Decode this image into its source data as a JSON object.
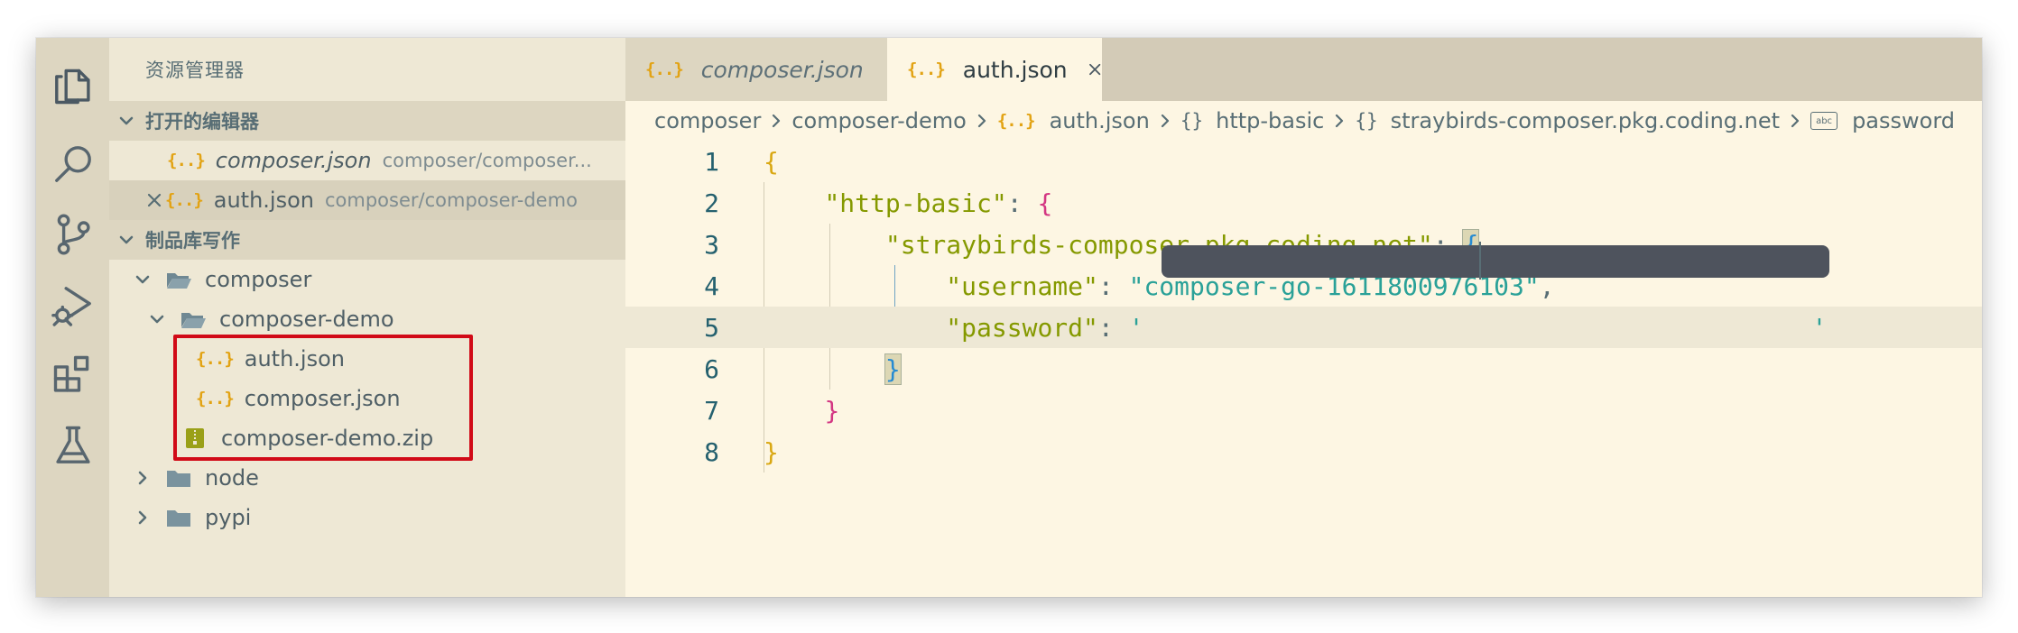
{
  "sidebar": {
    "title": "资源管理器",
    "open_editors": {
      "header": "打开的编辑器",
      "items": [
        {
          "name": "composer.json",
          "path": "composer/composer..."
        },
        {
          "name": "auth.json",
          "path": "composer/composer-demo"
        }
      ]
    },
    "repo": {
      "header": "制品库写作",
      "tree": [
        {
          "name": "composer"
        },
        {
          "name": "composer-demo"
        },
        {
          "name": "auth.json"
        },
        {
          "name": "composer.json"
        },
        {
          "name": "composer-demo.zip"
        },
        {
          "name": "node"
        },
        {
          "name": "pypi"
        }
      ]
    }
  },
  "tabs": [
    {
      "label": "composer.json"
    },
    {
      "label": "auth.json"
    }
  ],
  "breadcrumb": [
    "composer",
    "composer-demo",
    "auth.json",
    "http-basic",
    "straybirds-composer.pkg.coding.net",
    "password"
  ],
  "editor": {
    "line_numbers": [
      "1",
      "2",
      "3",
      "4",
      "5",
      "6",
      "7",
      "8"
    ],
    "tokens": {
      "open1": "{",
      "key_http": "\"http-basic\"",
      "colon": ": ",
      "open2": "{",
      "key_host": "\"straybirds-composer.pkg.coding.net\"",
      "open3": "{",
      "key_user": "\"username\"",
      "val_user": "\"composer-go-1611800976103\"",
      "comma": ",",
      "key_pass": "\"password\"",
      "quote": "'",
      "close3": "}",
      "close2": "}",
      "close1": "}"
    }
  },
  "colors": {
    "editor_bg": "#fdf6e3",
    "sidebar_bg": "#eee8d5",
    "highlight_border": "#d10a17",
    "redaction": "#4e535d"
  }
}
